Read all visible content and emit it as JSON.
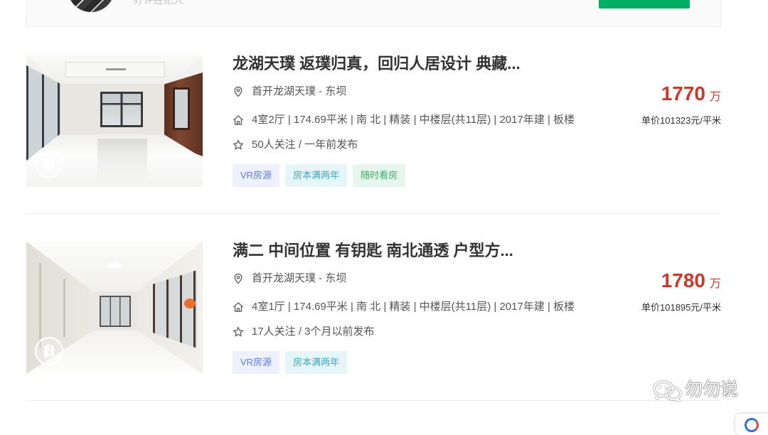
{
  "top_card": {
    "agent_label": "好评经纪人"
  },
  "listings": [
    {
      "title": "龙湖天璞 返璞归真，回归人居设计 典藏...",
      "location": "首开龙湖天璞 - 东坝",
      "house_info": "4室2厅 | 174.69平米 | 南 北 | 精装 | 中楼层(共11层) | 2017年建 | 板楼",
      "follow_info": "50人关注 / 一年前发布",
      "tags": [
        "VR房源",
        "房本满两年",
        "随时看房"
      ],
      "total_price": "1770",
      "price_unit": "万",
      "unit_price": "单价101323元/平米",
      "has_vr": true
    },
    {
      "title": "满二 中间位置 有钥匙 南北通透 户型方...",
      "location": "首开龙湖天璞 - 东坝",
      "house_info": "4室1厅 | 174.69平米 | 南 北 | 精装 | 中楼层(共11层) | 2017年建 | 板楼",
      "follow_info": "17人关注 / 3个月以前发布",
      "tags": [
        "VR房源",
        "房本满两年"
      ],
      "total_price": "1780",
      "price_unit": "万",
      "unit_price": "单价101895元/平米",
      "has_vr": true
    }
  ],
  "icons": {
    "location": "location-pin-icon",
    "house": "house-icon",
    "follow": "star-icon",
    "vr": "vr-icon",
    "watermark": "wechat-icon"
  },
  "watermark": {
    "text": "勿勿说"
  },
  "colors": {
    "price": "#c9392b",
    "primary_button": "#00ae66",
    "title": "#333333",
    "tag_vr_bg": "#edf0fd",
    "tag_vr_text": "#5b7ae0",
    "tag_cert_bg": "#e6f5f8",
    "tag_cert_text": "#3ea7bf",
    "tag_visit_bg": "#e7f6ec",
    "tag_visit_text": "#3caf63"
  }
}
